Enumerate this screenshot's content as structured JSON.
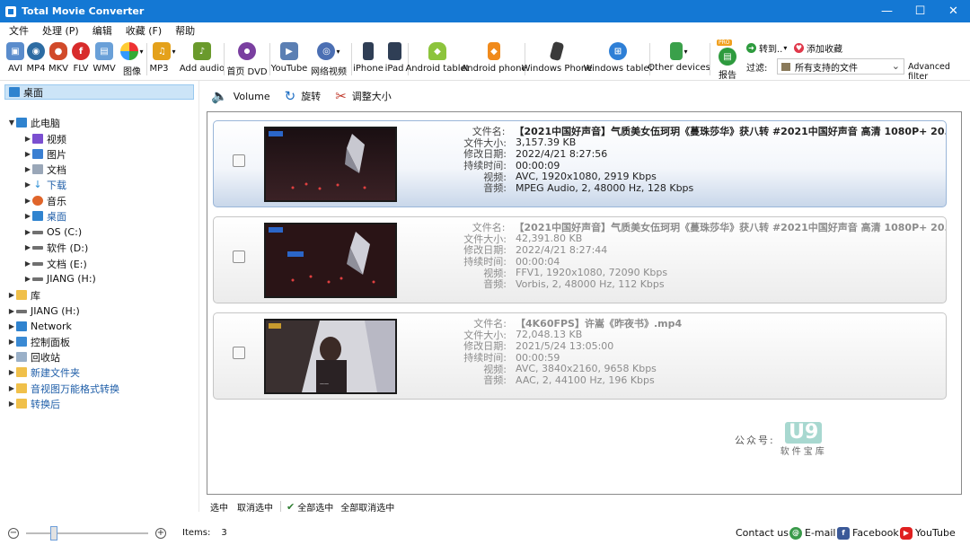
{
  "window": {
    "title": "Total Movie Converter",
    "controls": [
      "—",
      "☐",
      "✕"
    ]
  },
  "menu": [
    "文件",
    "处理 (P)",
    "编辑",
    "收藏 (F)",
    "帮助"
  ],
  "toolbar": [
    {
      "label": "AVI",
      "icon": "avi-icon",
      "color": "#5a8ccc"
    },
    {
      "label": "MP4",
      "icon": "mp4-icon",
      "color": "#2d6ca3"
    },
    {
      "label": "MKV",
      "icon": "mkv-icon",
      "color": "#d14a2a"
    },
    {
      "label": "FLV",
      "icon": "flv-icon",
      "color": "#d82b2b"
    },
    {
      "label": "WMV",
      "icon": "wmv-icon",
      "color": "#6aa0d8"
    },
    {
      "label": "图像",
      "icon": "image-icon",
      "color": "#e9a13a"
    },
    {
      "label": "MP3",
      "icon": "mp3-icon",
      "color": "#e4a11b"
    },
    {
      "label": "Add audio",
      "icon": "add-audio-icon",
      "color": "#6a9a2c"
    },
    {
      "label": "首页 DVD",
      "icon": "dvd-icon",
      "color": "#7a3fa0"
    },
    {
      "label": "YouTube",
      "icon": "youtube-icon",
      "color": "#5b7fb3"
    },
    {
      "label": "网络视频",
      "icon": "web-video-icon",
      "color": "#4b6fb3"
    },
    {
      "label": "iPhone",
      "icon": "iphone-icon",
      "color": "#2f3e55"
    },
    {
      "label": "iPad",
      "icon": "ipad-icon",
      "color": "#2f3e55"
    },
    {
      "label": "Android tablet",
      "icon": "android-tablet-icon",
      "color": "#8cc43c"
    },
    {
      "label": "Android phone",
      "icon": "android-phone-icon",
      "color": "#f08a1c"
    },
    {
      "label": "Windows Phone",
      "icon": "windows-phone-icon",
      "color": "#3a3a3a"
    },
    {
      "label": "Windows tablet",
      "icon": "windows-tablet-icon",
      "color": "#2e7fd6"
    },
    {
      "label": "Other devices",
      "icon": "other-devices-icon",
      "color": "#3aa04a"
    },
    {
      "label": "报告",
      "icon": "report-icon",
      "color": "#2e9b3e"
    }
  ],
  "actions": {
    "goto": "转到..",
    "add_favorite": "添加收藏",
    "filter_label": "过滤:",
    "filter_value": "所有支持的文件",
    "advanced_filter": "Advanced filter",
    "pro_badge": "PRO"
  },
  "tree": [
    {
      "label": "桌面",
      "level": 0,
      "selected": true,
      "icon_color": "#2f83cf"
    },
    {
      "label": "此电脑",
      "level": 0,
      "expanded": true,
      "icon_color": "#2f83cf"
    },
    {
      "label": "视频",
      "level": 1,
      "icon_color": "#7b4fd0"
    },
    {
      "label": "图片",
      "level": 1,
      "icon_color": "#3a7fd2"
    },
    {
      "label": "文档",
      "level": 1,
      "icon_color": "#9aa7b8"
    },
    {
      "label": "下载",
      "level": 1,
      "icon_color": "#2c8fd6",
      "blue": true
    },
    {
      "label": "音乐",
      "level": 1,
      "icon_color": "#e0652a"
    },
    {
      "label": "桌面",
      "level": 1,
      "icon_color": "#2f83cf",
      "blue": true
    },
    {
      "label": "OS (C:)",
      "level": 1,
      "icon_color": "#707070"
    },
    {
      "label": "软件 (D:)",
      "level": 1,
      "icon_color": "#707070"
    },
    {
      "label": "文档 (E:)",
      "level": 1,
      "icon_color": "#707070"
    },
    {
      "label": "JIANG (H:)",
      "level": 1,
      "icon_color": "#707070"
    },
    {
      "label": "库",
      "level": 0,
      "icon_color": "#f0c04a"
    },
    {
      "label": "JIANG (H:)",
      "level": 0,
      "icon_color": "#707070"
    },
    {
      "label": "Network",
      "level": 0,
      "icon_color": "#2f83cf"
    },
    {
      "label": "控制面板",
      "level": 0,
      "icon_color": "#3a8ad4"
    },
    {
      "label": "回收站",
      "level": 0,
      "icon_color": "#9ab0c8"
    },
    {
      "label": "新建文件夹",
      "level": 0,
      "icon_color": "#f0c04a",
      "blue": true
    },
    {
      "label": "音视图万能格式转换",
      "level": 0,
      "icon_color": "#f0c04a",
      "blue": true
    },
    {
      "label": "转换后",
      "level": 0,
      "icon_color": "#f0c04a",
      "blue": true
    }
  ],
  "content_toolbar": {
    "volume": "Volume",
    "rotate": "旋转",
    "resize": "调整大小"
  },
  "labels": {
    "name": "文件名:",
    "size": "文件大小:",
    "modified": "修改日期:",
    "duration": "持续时间:",
    "video": "视频:",
    "audio": "音频:"
  },
  "files": [
    {
      "name": "【2021中国好声音】气质美女伍珂玥《蔓珠莎华》获八转 #2021中国好声音 高清 1080P+ 20...",
      "size": "3,157.39 KB",
      "modified": "2022/4/21 8:27:56",
      "duration": "00:00:09",
      "video": "AVC, 1920x1080, 2919 Kbps",
      "audio": "MPEG Audio, 2, 48000 Hz, 128 Kbps",
      "active": true
    },
    {
      "name": "【2021中国好声音】气质美女伍珂玥《蔓珠莎华》获八转 #2021中国好声音 高清 1080P+ 20...",
      "size": "42,391.80 KB",
      "modified": "2022/4/21 8:27:44",
      "duration": "00:00:04",
      "video": "FFV1, 1920x1080, 72090 Kbps",
      "audio": "Vorbis, 2, 48000 Hz, 112 Kbps",
      "active": false
    },
    {
      "name": "【4K60FPS】许嵩《昨夜书》.mp4",
      "size": "72,048.13 KB",
      "modified": "2021/5/24 13:05:00",
      "duration": "00:00:59",
      "video": "AVC, 3840x2160, 9658 Kbps",
      "audio": "AAC, 2, 44100 Hz, 196 Kbps",
      "active": false
    }
  ],
  "watermark": {
    "prefix": "公众号:",
    "logo": "U9",
    "sub": "软件宝库"
  },
  "selection": {
    "select": "选中",
    "deselect": "取消选中",
    "select_all": "全部选中",
    "deselect_all": "全部取消选中"
  },
  "status": {
    "items_label": "Items:",
    "items_count": "3",
    "zoom_minus": "−",
    "zoom_plus": "+",
    "zoom_level": 0.2
  },
  "footer": {
    "contact": "Contact us",
    "email": "E-mail",
    "facebook": "Facebook",
    "youtube": "YouTube"
  }
}
